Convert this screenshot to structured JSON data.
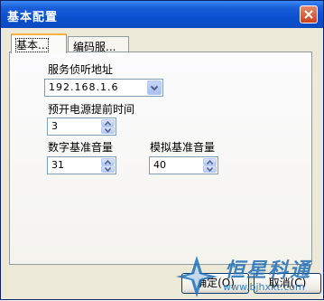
{
  "window": {
    "title": "基本配置"
  },
  "tabs": [
    {
      "label": "基本..."
    },
    {
      "label": "编码服..."
    }
  ],
  "form": {
    "server_address_label": "服务侦听地址",
    "server_address_value": "192.168.1.6",
    "precharge_label": "预开电源提前时间",
    "precharge_value": "3",
    "digital_volume_label": "数字基准音量",
    "digital_volume_value": "31",
    "analog_volume_label": "模拟基准音量",
    "analog_volume_value": "40"
  },
  "buttons": {
    "ok_label": "确定(O)",
    "cancel_label": "取消(C)"
  },
  "watermark": {
    "brand": "恒星科通",
    "url": "www.bjhxkt.com"
  },
  "colors": {
    "titlebar": "#0a50d0",
    "dialog_bg": "#ece9d8",
    "watermark_blue": "#1f6fb8"
  }
}
